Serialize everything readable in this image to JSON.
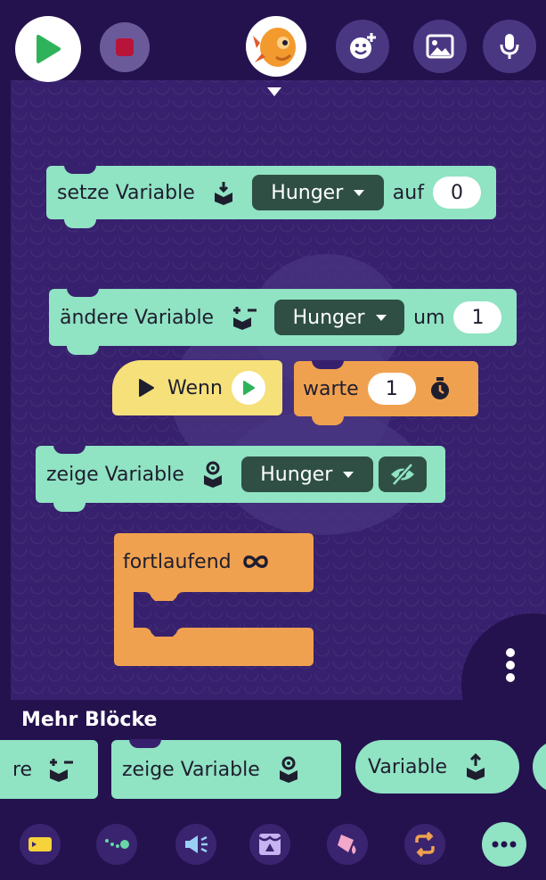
{
  "header": {
    "run_icon": "play-icon",
    "stop_icon": "stop-icon",
    "character_icon": "shrimp-character-icon",
    "add_character_icon": "add-character-icon",
    "background_icon": "image-icon",
    "sound_icon": "microphone-icon",
    "dropdown_icon": "caret-down-icon"
  },
  "blocks": {
    "set_variable": {
      "label": "setze Variable",
      "variable": "Hunger",
      "to_label": "auf",
      "value": "0"
    },
    "change_variable": {
      "label": "ändere Variable",
      "variable": "Hunger",
      "by_label": "um",
      "value": "1"
    },
    "when": {
      "label": "Wenn"
    },
    "wait": {
      "label": "warte",
      "value": "1"
    },
    "show_variable": {
      "label": "zeige Variable",
      "variable": "Hunger"
    },
    "forever": {
      "label": "fortlaufend"
    }
  },
  "tray": {
    "title": "Mehr Blöcke",
    "items": [
      {
        "label": "re"
      },
      {
        "label": "zeige Variable"
      },
      {
        "label": "Variable"
      }
    ]
  },
  "bottom_nav": {
    "icons": [
      "ticket-icon",
      "path-icon",
      "megaphone-icon",
      "stage-icon",
      "paint-icon",
      "repeat-icon",
      "more-icon"
    ]
  },
  "colors": {
    "canvas": "#37206d",
    "mint_block": "#90e3c3",
    "orange_block": "#f0a14f",
    "yellow_block": "#f6e07a",
    "dropdown": "#2f4f45",
    "nav_bg": "#24124e"
  }
}
